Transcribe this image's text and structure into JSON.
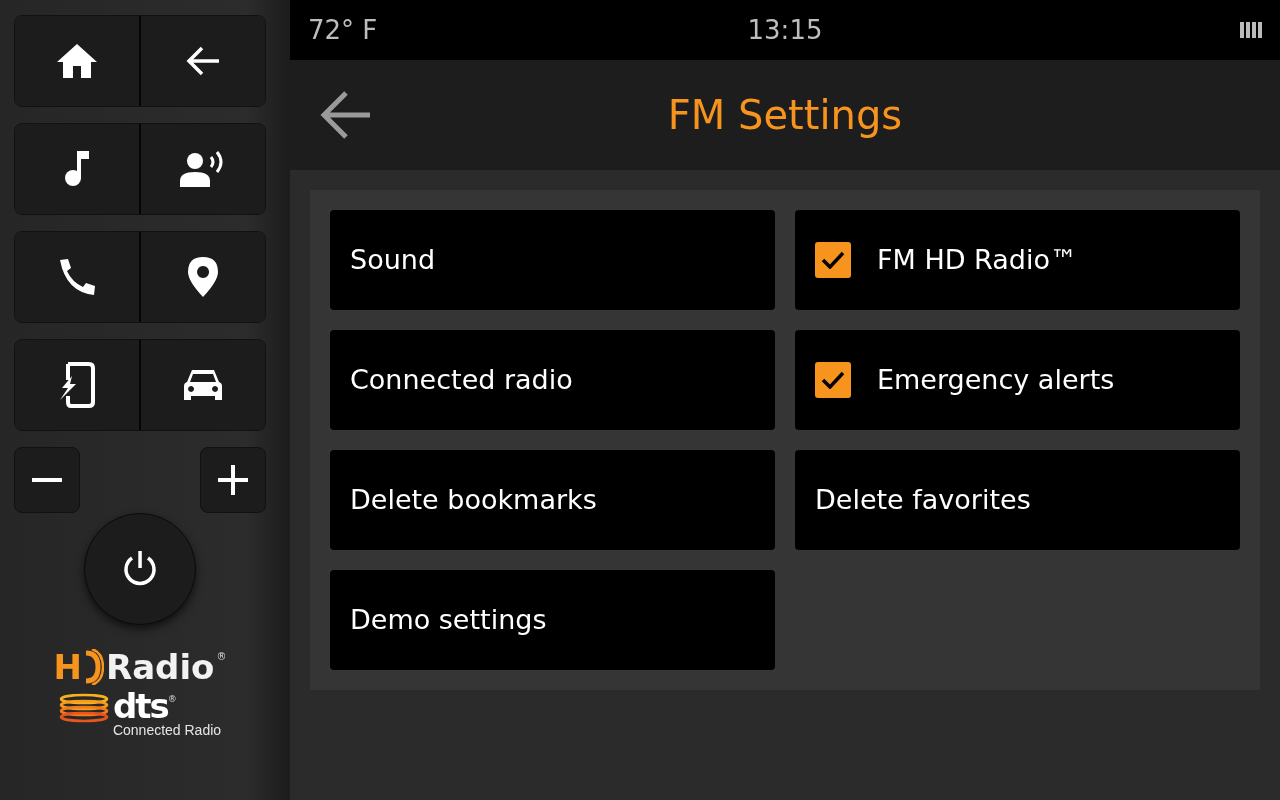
{
  "status_bar": {
    "temperature": "72° F",
    "time": "13:15"
  },
  "header": {
    "title": "FM Settings"
  },
  "settings": [
    {
      "kind": "plain",
      "label": "Sound"
    },
    {
      "kind": "checkbox",
      "label": "FM HD Radio™",
      "checked": true
    },
    {
      "kind": "plain",
      "label": "Connected radio"
    },
    {
      "kind": "checkbox",
      "label": "Emergency alerts",
      "checked": true
    },
    {
      "kind": "plain",
      "label": "Delete bookmarks"
    },
    {
      "kind": "plain",
      "label": "Delete favorites"
    },
    {
      "kind": "plain",
      "label": "Demo settings"
    }
  ],
  "logos": {
    "hd_letter": "H",
    "hd_name": "Radio",
    "hd_mark": "®",
    "dts_name": "dts",
    "dts_mark": "®",
    "dts_subtitle": "Connected Radio"
  }
}
